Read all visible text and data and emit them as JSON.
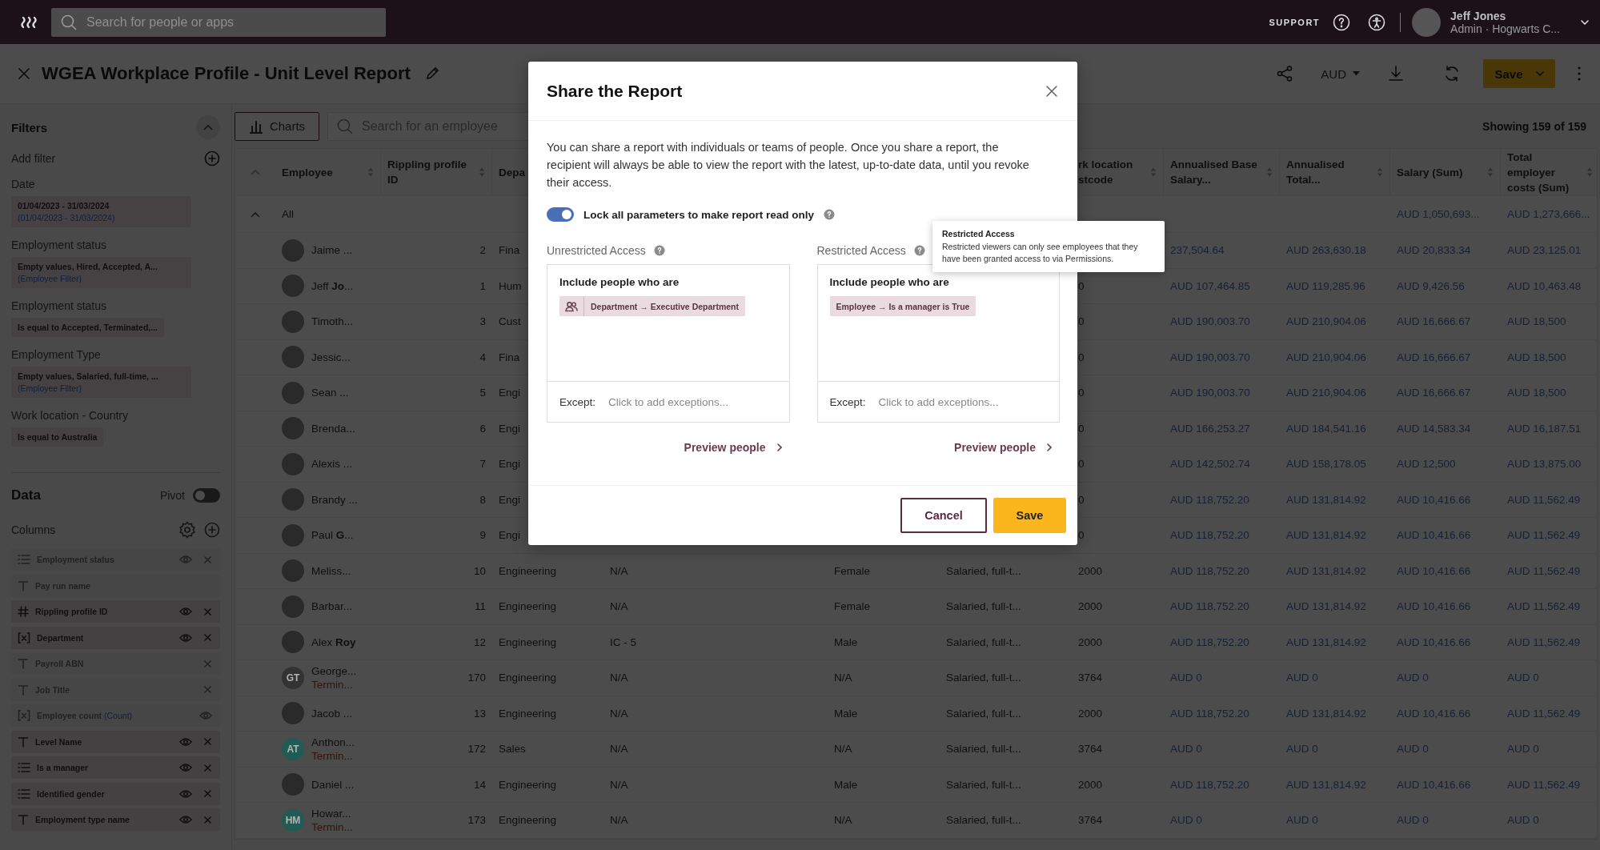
{
  "topbar": {
    "search_placeholder": "Search for people or apps",
    "support": "SUPPORT",
    "user_name": "Jeff Jones",
    "user_role": "Admin · Hogwarts C..."
  },
  "titlebar": {
    "title": "WGEA Workplace Profile - Unit Level Report",
    "currency": "AUD",
    "save": "Save"
  },
  "sidebar": {
    "filters_title": "Filters",
    "add_filter": "Add filter",
    "filters": [
      {
        "label": "Date",
        "value": "01/04/2023 - 31/03/2024",
        "note": "(01/04/2023 - 31/03/2024)"
      },
      {
        "label": "Employment status",
        "value": "Empty values, Hired, Accepted, A...",
        "note": "(Employee Filter)"
      },
      {
        "label": "Employment status",
        "value": "Is equal to Accepted, Terminated,..."
      },
      {
        "label": "Employment Type",
        "value": "Empty values, Salaried, full-time, ...",
        "note": "(Employee Filter)"
      },
      {
        "label": "Work location - Country",
        "value": "Is equal to Australia"
      }
    ],
    "data_title": "Data",
    "pivot": {
      "label": "Pivot",
      "on": false
    },
    "columns_title": "Columns",
    "columns": [
      {
        "kind": "list",
        "label": "Employment status",
        "active": false,
        "eye": true,
        "remove": true
      },
      {
        "kind": "text",
        "label": "Pay run name",
        "active": false,
        "eye": false,
        "remove": false
      },
      {
        "kind": "number",
        "label": "Rippling profile ID",
        "active": true,
        "eye": true,
        "remove": true
      },
      {
        "kind": "formula",
        "label": "Department",
        "active": true,
        "eye": true,
        "remove": true
      },
      {
        "kind": "text",
        "label": "Payroll ABN",
        "active": false,
        "eye": false,
        "remove": true
      },
      {
        "kind": "text",
        "label": "Job Title",
        "active": false,
        "eye": false,
        "remove": true
      },
      {
        "kind": "formula",
        "label": "Employee count",
        "aggregate": "(Count)",
        "active": false,
        "eye": true,
        "remove": false
      },
      {
        "kind": "text",
        "label": "Level Name",
        "active": true,
        "eye": true,
        "remove": true
      },
      {
        "kind": "list",
        "label": "Is a manager",
        "active": true,
        "eye": true,
        "remove": true
      },
      {
        "kind": "list",
        "label": "Identified gender",
        "active": true,
        "eye": true,
        "remove": true
      },
      {
        "kind": "text",
        "label": "Employment type name",
        "active": true,
        "eye": true,
        "remove": true
      }
    ]
  },
  "toolbar": {
    "charts": "Charts",
    "search_placeholder": "Search for an employee",
    "showing": "Showing 159 of 159"
  },
  "table": {
    "columns": [
      {
        "label": "Employee",
        "sortable": true
      },
      {
        "label": "Rippling profile ID",
        "sortable": true
      },
      {
        "label": "Depa",
        "sortable": false
      },
      {
        "label": "rk location stcode",
        "sortable": true
      },
      {
        "label": "Annualised Base Salary...",
        "sortable": true
      },
      {
        "label": "Annualised Total...",
        "sortable": true
      },
      {
        "label": "Salary (Sum)",
        "sortable": true
      },
      {
        "label": "Total employer costs (Sum)",
        "sortable": true
      }
    ],
    "total_row": {
      "label": "All",
      "salary": "AUD 1,050,693...",
      "employer": "AUD 1,273,666..."
    },
    "rows": [
      {
        "avatar": {
          "kind": "photo"
        },
        "employee": "Jaime ...",
        "id": "2",
        "department": "Fina",
        "base": "237,504.64",
        "total": "AUD 263,630.18",
        "salary": "AUD 20,833.34",
        "employer": "AUD 23,125.01"
      },
      {
        "avatar": {
          "kind": "photo"
        },
        "employee": "Jeff **Jo**...",
        "id": "1",
        "department": "Hum",
        "postcode": "0",
        "base": "AUD 107,464.85",
        "total": "AUD 119,285.96",
        "salary": "AUD 9,426.56",
        "employer": "AUD 10,463.48"
      },
      {
        "avatar": {
          "kind": "photo"
        },
        "employee": "Timoth...",
        "id": "3",
        "department": "Cust",
        "postcode": "0",
        "base": "AUD 190,003.70",
        "total": "AUD 210,904.06",
        "salary": "AUD 16,666.67",
        "employer": "AUD 18,500"
      },
      {
        "avatar": {
          "kind": "photo"
        },
        "employee": "Jessic...",
        "id": "4",
        "department": "Fina",
        "postcode": "0",
        "base": "AUD 190,003.70",
        "total": "AUD 210,904.06",
        "salary": "AUD 16,666.67",
        "employer": "AUD 18,500"
      },
      {
        "avatar": {
          "kind": "photo"
        },
        "employee": "Sean ...",
        "id": "5",
        "department": "Engi",
        "postcode": "0",
        "base": "AUD 190,003.70",
        "total": "AUD 210,904.06",
        "salary": "AUD 16,666.67",
        "employer": "AUD 18,500"
      },
      {
        "avatar": {
          "kind": "photo"
        },
        "employee": "Brenda...",
        "id": "6",
        "department": "Engi",
        "postcode": "0",
        "base": "AUD 166,253.27",
        "total": "AUD 184,541.16",
        "salary": "AUD 14,583.34",
        "employer": "AUD 16,187.51"
      },
      {
        "avatar": {
          "kind": "photo"
        },
        "employee": "Alexis ...",
        "id": "7",
        "department": "Engi",
        "postcode": "0",
        "base": "AUD 142,502.74",
        "total": "AUD 158,178.05",
        "salary": "AUD 12,500",
        "employer": "AUD 13,875.00"
      },
      {
        "avatar": {
          "kind": "photo"
        },
        "employee": "Brandy ...",
        "id": "8",
        "department": "Engi",
        "postcode": "0",
        "base": "AUD 118,752.20",
        "total": "AUD 131,814.92",
        "salary": "AUD 10,416.66",
        "employer": "AUD 11,562.49"
      },
      {
        "avatar": {
          "kind": "photo"
        },
        "employee": "Paul **G**...",
        "id": "9",
        "department": "Engi",
        "postcode": "0",
        "base": "AUD 118,752.20",
        "total": "AUD 131,814.92",
        "salary": "AUD 10,416.66",
        "employer": "AUD 11,562.49"
      },
      {
        "avatar": {
          "kind": "photo"
        },
        "employee": "Meliss...",
        "id": "10",
        "department": "Engineering",
        "level": "N/A",
        "gender": "Female",
        "employment_type": "Salaried, full-t...",
        "postcode": "2000",
        "base": "AUD 118,752.20",
        "total": "AUD 131,814.92",
        "salary": "AUD 10,416.66",
        "employer": "AUD 11,562.49"
      },
      {
        "avatar": {
          "kind": "photo"
        },
        "employee": "Barbar...",
        "id": "11",
        "department": "Engineering",
        "level": "N/A",
        "gender": "Female",
        "employment_type": "Salaried, full-t...",
        "postcode": "2000",
        "base": "AUD 118,752.20",
        "total": "AUD 131,814.92",
        "salary": "AUD 10,416.66",
        "employer": "AUD 11,562.49"
      },
      {
        "avatar": {
          "kind": "photo"
        },
        "employee": "Alex **Roy**",
        "id": "12",
        "department": "Engineering",
        "level": "IC - 5",
        "gender": "Male",
        "employment_type": "Salaried, full-t...",
        "postcode": "2000",
        "base": "AUD 118,752.20",
        "total": "AUD 131,814.92",
        "salary": "AUD 10,416.66",
        "employer": "AUD 11,562.49"
      },
      {
        "avatar": {
          "kind": "initials",
          "initials": "GT",
          "color": "#333333"
        },
        "employee": "George...",
        "status": "Termin...",
        "id": "170",
        "department": "Engineering",
        "level": "N/A",
        "gender": "N/A",
        "employment_type": "Salaried, full-t...",
        "postcode": "3764",
        "base": "AUD 0",
        "total": "AUD 0",
        "salary": "AUD 0",
        "employer": "AUD 0"
      },
      {
        "avatar": {
          "kind": "photo"
        },
        "employee": "Jacob ...",
        "id": "13",
        "department": "Engineering",
        "level": "N/A",
        "gender": "Male",
        "employment_type": "Salaried, full-t...",
        "postcode": "2000",
        "base": "AUD 118,752.20",
        "total": "AUD 131,814.92",
        "salary": "AUD 10,416.66",
        "employer": "AUD 11,562.49"
      },
      {
        "avatar": {
          "kind": "initials",
          "initials": "AT",
          "color": "#1e5c54"
        },
        "employee": "Anthon...",
        "status": "Termin...",
        "id": "172",
        "department": "Sales",
        "level": "N/A",
        "gender": "N/A",
        "employment_type": "Salaried, full-t...",
        "postcode": "3764",
        "base": "AUD 0",
        "total": "AUD 0",
        "salary": "AUD 0",
        "employer": "AUD 0"
      },
      {
        "avatar": {
          "kind": "photo"
        },
        "employee": "Daniel ...",
        "id": "14",
        "department": "Engineering",
        "level": "N/A",
        "gender": "Male",
        "employment_type": "Salaried, full-t...",
        "postcode": "2000",
        "base": "AUD 118,752.20",
        "total": "AUD 131,814.92",
        "salary": "AUD 10,416.66",
        "employer": "AUD 11,562.49"
      },
      {
        "avatar": {
          "kind": "initials",
          "initials": "HM",
          "color": "#1e5c54"
        },
        "employee": "Howar...",
        "status": "Termin...",
        "id": "173",
        "department": "Engineering",
        "level": "N/A",
        "gender": "N/A",
        "employment_type": "Salaried, full-t...",
        "postcode": "3764",
        "base": "AUD 0",
        "total": "AUD 0",
        "salary": "AUD 0",
        "employer": "AUD 0"
      }
    ]
  },
  "modal": {
    "title": "Share the Report",
    "description": "You can share a report with individuals or teams of people. Once you share a report, the recipient will always be able to view the report with the latest, up-to-date data, until you revoke their access.",
    "lock_toggle": {
      "label": "Lock all parameters to make report read only",
      "on": true
    },
    "panels": [
      {
        "title": "Unrestricted Access",
        "include_label": "Include people who are",
        "chip": {
          "kind": "group",
          "text": "Department → Executive Department"
        },
        "except_label": "Except:",
        "except_placeholder": "Click to add exceptions...",
        "preview": "Preview people"
      },
      {
        "title": "Restricted Access",
        "include_label": "Include people who are",
        "chip": {
          "kind": "plain",
          "text": "Employee → Is a manager is True"
        },
        "except_label": "Except:",
        "except_placeholder": "Click to add exceptions...",
        "preview": "Preview people"
      }
    ],
    "cancel": "Cancel",
    "save": "Save"
  },
  "tooltip": {
    "title": "Restricted Access",
    "body": "Restricted viewers can only see employees that they have been granted access to via Permissions."
  }
}
